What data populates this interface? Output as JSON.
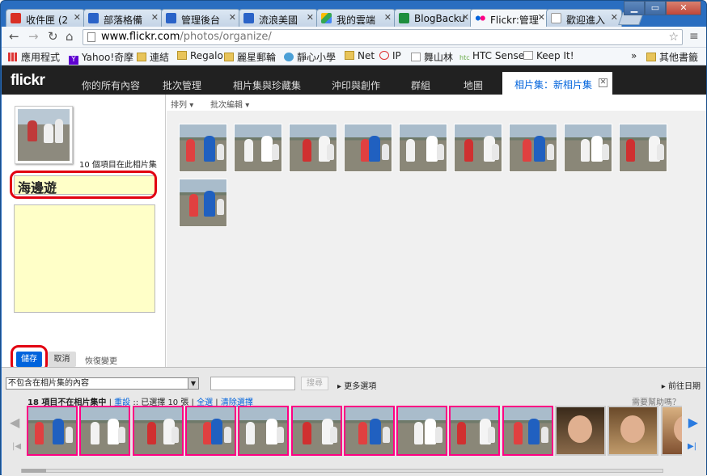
{
  "browser": {
    "tabs": [
      {
        "label": "收件匣 (2",
        "icon": "gmail-icon",
        "color": "#d93025"
      },
      {
        "label": "部落格備",
        "icon": "blogger-icon",
        "color": "#2a63c8"
      },
      {
        "label": "管理後台",
        "icon": "blogger-icon",
        "color": "#2a63c8"
      },
      {
        "label": "流浪美國",
        "icon": "blogger-icon",
        "color": "#2a63c8"
      },
      {
        "label": "我的雲端",
        "icon": "drive-icon",
        "color": "#2aa74a"
      },
      {
        "label": "BlogBacku",
        "icon": "sheet-icon",
        "color": "#1e8e3e"
      },
      {
        "label": "Flickr:管理",
        "icon": "flickr-icon",
        "color": "#ff0084"
      },
      {
        "label": "歡迎進入",
        "icon": "page-icon",
        "color": "#dddddd"
      }
    ],
    "url_prefix": "www.flickr.com",
    "url_path": "/photos/organize/",
    "bookmarks": [
      "應用程式",
      "Yahoo!奇摩",
      "連結",
      "Regalo",
      "麗星郵輪",
      "靜心小學",
      "Net",
      "IP",
      "舞山林",
      "HTC Sense",
      "Keep It!"
    ],
    "bookmarks_more": "»",
    "other_bookmarks": "其他書籤"
  },
  "flickr": {
    "logo": "flickr",
    "nav": [
      "你的所有內容",
      "批次管理",
      "相片集與珍藏集",
      "沖印與創作",
      "群組",
      "地圖"
    ],
    "active_tab": "相片集：新相片集",
    "sort_label": "排列",
    "batch_label": "批次編輯",
    "item_count": "10 個項目在此相片集",
    "title_value": "海邊遊",
    "save": "儲存",
    "cancel": "取消",
    "revert": "恢復變更",
    "filter": "不包含在相片集的內容",
    "search": "搜尋",
    "more_options": "更多選項",
    "goto_date": "前往日期",
    "status_count": "18 項目不在相片集中",
    "status_sep1": "|",
    "status_reset": "重設",
    "status_selected": ":: 已選擇 10 張",
    "status_sep2": "|",
    "status_all": "全選",
    "status_sep3": "|",
    "status_clear": "清除選擇",
    "help": "需要幫助嗎？"
  },
  "colors": {
    "flickr_blue": "#0063dc",
    "flickr_pink": "#ff0084",
    "highlight_red": "#e20010"
  }
}
